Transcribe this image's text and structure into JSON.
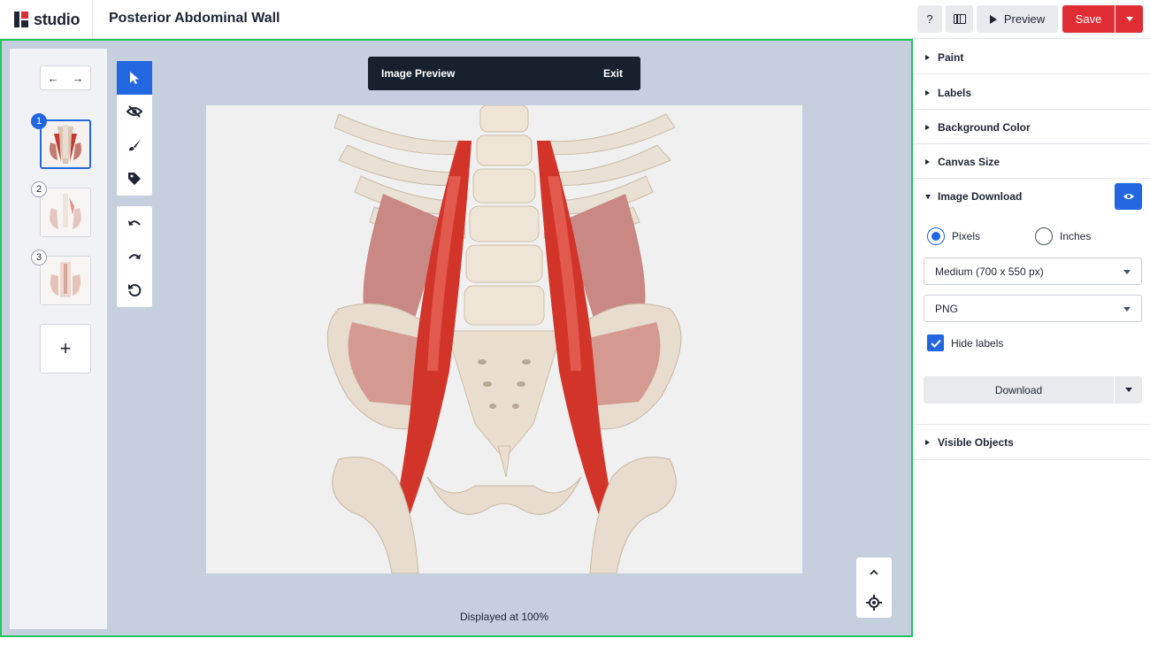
{
  "header": {
    "brand": "studio",
    "title": "Posterior Abdominal Wall",
    "help_label": "?",
    "preview_label": "Preview",
    "save_label": "Save"
  },
  "slides": {
    "nav_prev": "←",
    "nav_next": "→",
    "items": [
      {
        "number": "1",
        "active": true
      },
      {
        "number": "2",
        "active": false
      },
      {
        "number": "3",
        "active": false
      }
    ],
    "add_label": "+"
  },
  "tools": {
    "items": [
      "select-tool",
      "hide-tool",
      "paint-tool",
      "label-tool"
    ],
    "history": [
      "undo",
      "redo",
      "reset"
    ]
  },
  "preview_banner": {
    "label": "Image Preview",
    "exit_label": "Exit"
  },
  "canvas": {
    "status": "Displayed at 100%",
    "background": "#f0f0f0"
  },
  "sidebar": {
    "sections": {
      "paint": "Paint",
      "labels": "Labels",
      "background_color": "Background Color",
      "canvas_size": "Canvas Size",
      "image_download": "Image Download",
      "visible_objects": "Visible Objects"
    },
    "image_download": {
      "units": [
        {
          "label": "Pixels",
          "selected": true
        },
        {
          "label": "Inches",
          "selected": false
        }
      ],
      "size_value": "Medium (700 x 550 px)",
      "format_value": "PNG",
      "hide_labels_label": "Hide labels",
      "hide_labels_checked": true,
      "download_label": "Download"
    }
  },
  "colors": {
    "accent": "#2367e0",
    "brand_red": "#e02d34",
    "focus_border": "#22c55e",
    "workspace": "#c5cfdd"
  }
}
